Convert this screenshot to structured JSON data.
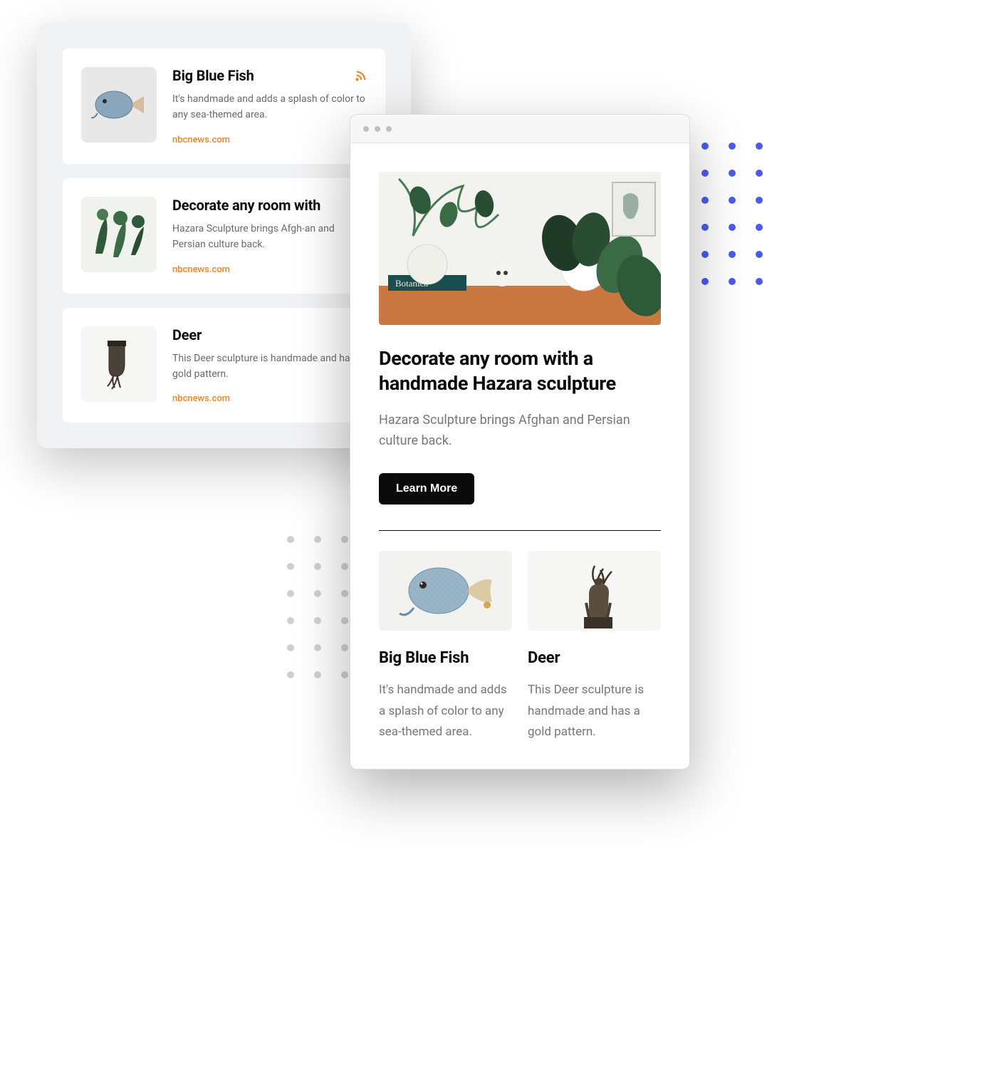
{
  "leftPanel": {
    "cards": [
      {
        "title": "Big Blue Fish",
        "description": "It's handmade and adds a splash of color to any sea-themed area.",
        "source": "nbcnews.com",
        "hasRss": true,
        "thumb": "fish"
      },
      {
        "title": "Decorate any room with",
        "description": "Hazara Sculpture brings Afgh-an and Persian culture back.",
        "source": "nbcnews.com",
        "hasRss": false,
        "thumb": "plants"
      },
      {
        "title": "Deer",
        "description": "This Deer sculpture is handmade and has a gold pattern.",
        "source": "nbcnews.com",
        "hasRss": false,
        "thumb": "deer-inverted"
      }
    ]
  },
  "browser": {
    "hero": {
      "title": "Decorate any room with a handmade Hazara sculpture",
      "description": "Hazara Sculpture brings Afghan and Persian culture back.",
      "buttonLabel": "Learn More"
    },
    "subCards": [
      {
        "title": "Big Blue Fish",
        "description": "It's handmade and adds a splash of color to any sea-themed area.",
        "thumb": "fish"
      },
      {
        "title": "Deer",
        "description": "This Deer sculpture is handmade and has a gold pattern.",
        "thumb": "deer"
      }
    ]
  }
}
